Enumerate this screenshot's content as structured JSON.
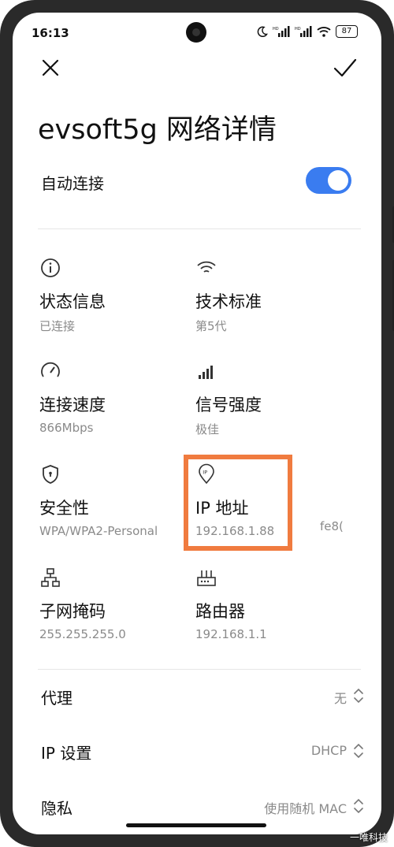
{
  "status_bar": {
    "time": "16:13",
    "battery": "87",
    "icons": [
      "moon-icon",
      "hd-signal-icon",
      "hd-signal-icon",
      "wifi-icon",
      "battery-icon"
    ]
  },
  "header": {
    "title": "evsoft5g 网络详情",
    "close_icon": "close-icon",
    "confirm_icon": "check-icon"
  },
  "auto_connect": {
    "label": "自动连接",
    "enabled": true
  },
  "details": [
    {
      "icon": "info-icon",
      "name": "状态信息",
      "value": "已连接"
    },
    {
      "icon": "wifi-icon",
      "name": "技术标准",
      "value": "第5代"
    },
    {
      "icon": "speedometer-icon",
      "name": "连接速度",
      "value": "866Mbps"
    },
    {
      "icon": "signal-bars-icon",
      "name": "信号强度",
      "value": "极佳"
    },
    {
      "icon": "shield-icon",
      "name": "安全性",
      "value": "WPA/WPA2-Personal"
    },
    {
      "icon": "ip-location-icon",
      "name": "IP 地址",
      "value": "192.168.1.88",
      "extra": "fe8("
    },
    {
      "icon": "network-tree-icon",
      "name": "子网掩码",
      "value": "255.255.255.0"
    },
    {
      "icon": "router-icon",
      "name": "路由器",
      "value": "192.168.1.1"
    }
  ],
  "settings": [
    {
      "label": "代理",
      "value": "无"
    },
    {
      "label": "IP 设置",
      "value": "DHCP"
    },
    {
      "label": "隐私",
      "value": "使用随机 MAC"
    }
  ],
  "watermark": "一唯科技",
  "colors": {
    "accent": "#3a7cf0",
    "highlight": "#f07b3f",
    "secondary_text": "#8a8a8a"
  }
}
